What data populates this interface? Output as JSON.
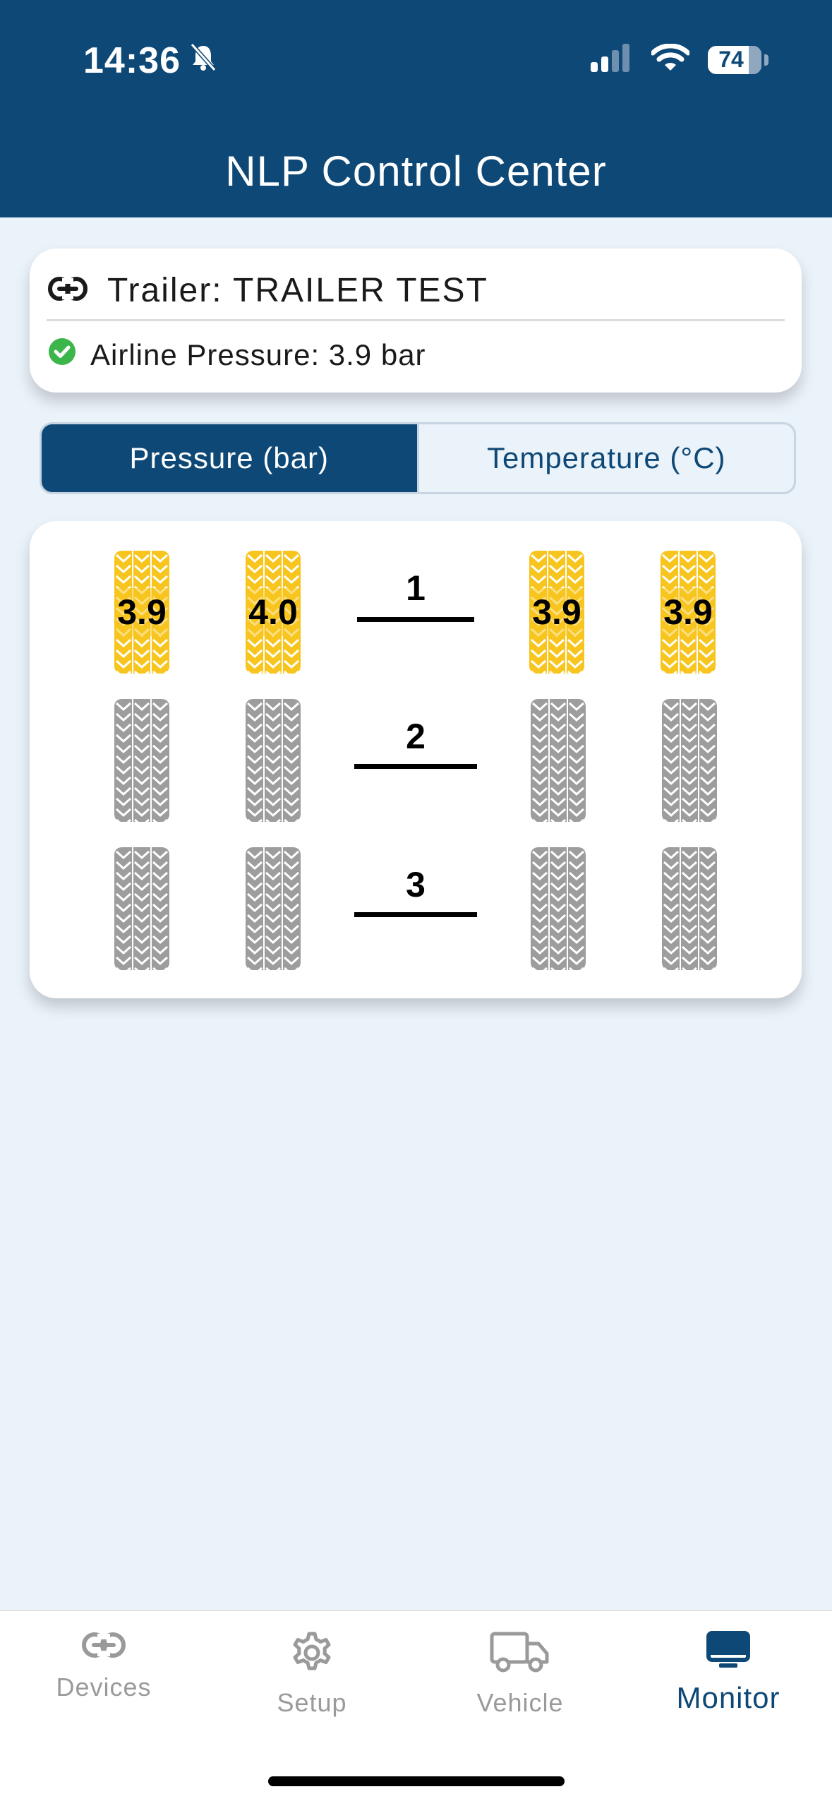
{
  "status": {
    "time": "14:36",
    "battery": "74"
  },
  "header": {
    "title": "NLP Control Center"
  },
  "trailer": {
    "label": "Trailer: TRAILER TEST",
    "airline": "Airline Pressure: 3.9 bar"
  },
  "tabs_toggle": {
    "pressure": "Pressure (bar)",
    "temperature": "Temperature (°C)"
  },
  "axles": [
    {
      "number": "1",
      "tires": [
        "3.9",
        "4.0",
        "3.9",
        "3.9"
      ]
    },
    {
      "number": "2",
      "tires": [
        "",
        "",
        "",
        ""
      ]
    },
    {
      "number": "3",
      "tires": [
        "",
        "",
        "",
        ""
      ]
    }
  ],
  "colors": {
    "primary": "#0e4876",
    "active_tire": "#f7c51e",
    "inactive_tire": "#9d9d9d",
    "ok": "#3cb54a"
  },
  "nav": {
    "devices": "Devices",
    "setup": "Setup",
    "vehicle": "Vehicle",
    "monitor": "Monitor"
  }
}
